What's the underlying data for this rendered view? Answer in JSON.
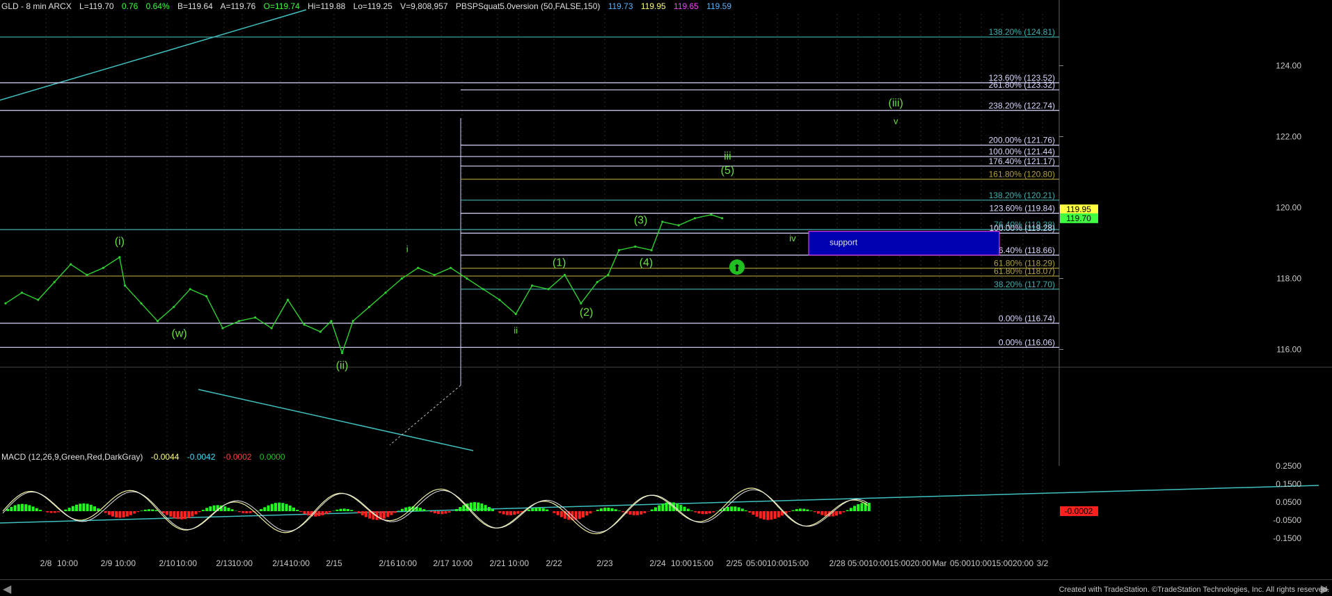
{
  "header": {
    "symbol": "GLD - 8 min  ARCX",
    "last": "L=119.70",
    "change": "0.76",
    "pct": "0.64%",
    "bid": "B=119.64",
    "ask": "A=119.76",
    "open": "O=119.74",
    "hi": "Hi=119.88",
    "lo": "Lo=119.25",
    "vol": "V=9,808,957",
    "indicator": "PBSPSquat5.0version (50,FALSE,150)",
    "ind_values": [
      "119.73",
      "119.95",
      "119.65",
      "119.59"
    ],
    "ind_colors": [
      "#5ab4ff",
      "#ffff80",
      "#ff40ff",
      "#5ab4ff"
    ]
  },
  "macd_header": {
    "label": "MACD (12,26,9,Green,Red,DarkGray)",
    "values": [
      "-0.0044",
      "-0.0042",
      "-0.0002",
      "0.0000"
    ],
    "colors": [
      "#ffff80",
      "#40e0ff",
      "#ff4040",
      "#20c020"
    ]
  },
  "footer_text": "Created with TradeStation. ©TradeStation Technologies, Inc. All rights reserved.",
  "colors": {
    "price": "#30d030",
    "fib_white": "#d8d8ff",
    "fib_olive": "#b0a040",
    "fib_teal": "#40b0b0",
    "trendline": "#40c0c0",
    "support_box": "#0000b0",
    "wave_green": "#6adf40",
    "macd_up": "#20ff20",
    "macd_down": "#ff2020"
  },
  "chart_data": {
    "type": "line",
    "title": "GLD - 8 min",
    "x_ticks": [
      "2/8",
      "10:00",
      "2/9",
      "10:00",
      "2/10",
      "10:00",
      "2/13",
      "10:00",
      "2/14",
      "10:00",
      "2/15",
      "2/16",
      "10:00",
      "2/17",
      "10:00",
      "2/21",
      "10:00",
      "2/22",
      "2/23",
      "2/24",
      "10:00",
      "15:00",
      "2/25",
      "05:00",
      "10:00",
      "15:00",
      "2/28",
      "05:00",
      "10:00",
      "15:00",
      "20:00",
      "Mar",
      "05:00",
      "10:00",
      "15:00",
      "20:00",
      "3/2"
    ],
    "y_ticks": [
      "124.00",
      "122.00",
      "120.00",
      "118.00",
      "116.00"
    ],
    "ylim": [
      115.5,
      125.5
    ],
    "price_series": [
      {
        "x": 0,
        "y": 117.3
      },
      {
        "x": 3,
        "y": 117.6
      },
      {
        "x": 6,
        "y": 117.4
      },
      {
        "x": 9,
        "y": 117.9
      },
      {
        "x": 12,
        "y": 118.4
      },
      {
        "x": 15,
        "y": 118.1
      },
      {
        "x": 18,
        "y": 118.3
      },
      {
        "x": 21,
        "y": 118.6
      },
      {
        "x": 22,
        "y": 117.8
      },
      {
        "x": 25,
        "y": 117.3
      },
      {
        "x": 28,
        "y": 116.8
      },
      {
        "x": 31,
        "y": 117.2
      },
      {
        "x": 34,
        "y": 117.7
      },
      {
        "x": 37,
        "y": 117.5
      },
      {
        "x": 40,
        "y": 116.6
      },
      {
        "x": 43,
        "y": 116.8
      },
      {
        "x": 46,
        "y": 116.9
      },
      {
        "x": 49,
        "y": 116.6
      },
      {
        "x": 52,
        "y": 117.4
      },
      {
        "x": 55,
        "y": 116.7
      },
      {
        "x": 58,
        "y": 116.5
      },
      {
        "x": 60,
        "y": 116.8
      },
      {
        "x": 62,
        "y": 115.9
      },
      {
        "x": 64,
        "y": 116.8
      },
      {
        "x": 67,
        "y": 117.2
      },
      {
        "x": 70,
        "y": 117.6
      },
      {
        "x": 73,
        "y": 118.0
      },
      {
        "x": 76,
        "y": 118.3
      },
      {
        "x": 79,
        "y": 118.1
      },
      {
        "x": 82,
        "y": 118.3
      },
      {
        "x": 85,
        "y": 118.0
      },
      {
        "x": 88,
        "y": 117.7
      },
      {
        "x": 91,
        "y": 117.4
      },
      {
        "x": 94,
        "y": 117.0
      },
      {
        "x": 97,
        "y": 117.8
      },
      {
        "x": 100,
        "y": 117.7
      },
      {
        "x": 103,
        "y": 118.1
      },
      {
        "x": 106,
        "y": 117.3
      },
      {
        "x": 109,
        "y": 117.9
      },
      {
        "x": 111,
        "y": 118.1
      },
      {
        "x": 113,
        "y": 118.8
      },
      {
        "x": 116,
        "y": 118.9
      },
      {
        "x": 119,
        "y": 118.8
      },
      {
        "x": 121,
        "y": 119.6
      },
      {
        "x": 124,
        "y": 119.5
      },
      {
        "x": 127,
        "y": 119.7
      },
      {
        "x": 130,
        "y": 119.8
      },
      {
        "x": 132,
        "y": 119.7
      }
    ],
    "fib_levels": [
      {
        "label": "138.20% (124.81)",
        "y": 124.81,
        "color": "teal",
        "from": "left"
      },
      {
        "label": "123.60% (123.52)",
        "y": 123.52,
        "color": "white",
        "from": "left"
      },
      {
        "label": "261.80% (123.32)",
        "y": 123.32,
        "color": "white",
        "from": "mid"
      },
      {
        "label": "238.20% (122.74)",
        "y": 122.74,
        "color": "white",
        "from": "left"
      },
      {
        "label": "200.00% (121.76)",
        "y": 121.76,
        "color": "white",
        "from": "mid"
      },
      {
        "label": "100.00% (121.44)",
        "y": 121.44,
        "color": "white",
        "from": "left"
      },
      {
        "label": "176.40% (121.17)",
        "y": 121.17,
        "color": "white",
        "from": "mid"
      },
      {
        "label": "161.80% (120.80)",
        "y": 120.8,
        "color": "olive",
        "from": "mid"
      },
      {
        "label": "138.20% (120.21)",
        "y": 120.21,
        "color": "teal",
        "from": "mid"
      },
      {
        "label": "123.60% (119.84)",
        "y": 119.84,
        "color": "white",
        "from": "mid"
      },
      {
        "label": "76.40% (119.38)",
        "y": 119.38,
        "color": "teal",
        "from": "left"
      },
      {
        "label": "100.00% (119.28)",
        "y": 119.28,
        "color": "white",
        "from": "mid"
      },
      {
        "label": "76.40% (118.66)",
        "y": 118.66,
        "color": "white",
        "from": "mid"
      },
      {
        "label": "61.80% (118.29)",
        "y": 118.29,
        "color": "olive",
        "from": "mid"
      },
      {
        "label": "61.80% (118.07)",
        "y": 118.07,
        "color": "olive",
        "from": "left"
      },
      {
        "label": "38.20% (117.70)",
        "y": 117.7,
        "color": "teal",
        "from": "mid"
      },
      {
        "label": "0.00% (116.74)",
        "y": 116.74,
        "color": "white",
        "from": "left"
      },
      {
        "label": "0.00% (116.06)",
        "y": 116.06,
        "color": "white",
        "from": "left"
      }
    ],
    "wave_labels": [
      {
        "text": "(i)",
        "x": 21,
        "y": 118.95
      },
      {
        "text": "(w)",
        "x": 32,
        "y": 116.35
      },
      {
        "text": "(ii)",
        "x": 62,
        "y": 115.45
      },
      {
        "text": "i",
        "x": 74,
        "y": 118.75
      },
      {
        "text": "ii",
        "x": 94,
        "y": 116.45
      },
      {
        "text": "(1)",
        "x": 102,
        "y": 118.35
      },
      {
        "text": "(2)",
        "x": 107,
        "y": 116.95
      },
      {
        "text": "(3)",
        "x": 117,
        "y": 119.55
      },
      {
        "text": "(4)",
        "x": 118,
        "y": 118.35
      },
      {
        "text": "(5)",
        "x": 133,
        "y": 120.95
      },
      {
        "text": "iii",
        "x": 133,
        "y": 121.35
      },
      {
        "text": "iv",
        "x": 145,
        "y": 119.05
      },
      {
        "text": "v",
        "x": 164,
        "y": 122.35
      },
      {
        "text": "(iii)",
        "x": 164,
        "y": 122.85
      }
    ],
    "price_tags": [
      {
        "label": "119.95",
        "y": 119.95,
        "color": "#ffff40"
      },
      {
        "label": "119.70",
        "y": 119.7,
        "color": "#40ff40"
      }
    ],
    "support_box": {
      "label": "support",
      "y_top": 119.33,
      "y_bottom": 118.66
    },
    "macd_y_ticks": [
      "0.2500",
      "0.1500",
      "0.0500",
      "-0.0500",
      "-0.1500"
    ],
    "macd_tag": "-0.0002"
  }
}
